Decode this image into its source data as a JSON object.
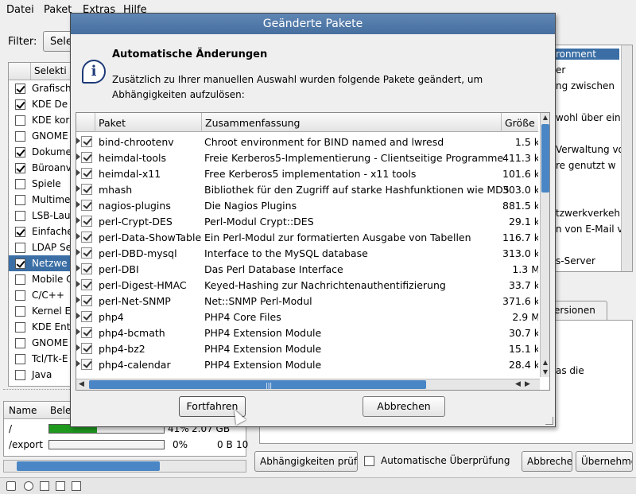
{
  "menubar": {
    "items": [
      "Datei",
      "Paket",
      "Extras",
      "Hilfe"
    ]
  },
  "filter": {
    "label": "Filter:",
    "value": "Sele"
  },
  "selections": {
    "header": "Selekti",
    "items": [
      {
        "label": "Grafisch",
        "checked": true,
        "selected": false
      },
      {
        "label": "KDE De",
        "checked": true,
        "selected": false
      },
      {
        "label": "KDE kor",
        "checked": false,
        "selected": false
      },
      {
        "label": "GNOME",
        "checked": false,
        "selected": false
      },
      {
        "label": "Dokume",
        "checked": true,
        "selected": false
      },
      {
        "label": "Büroanv",
        "checked": true,
        "selected": false
      },
      {
        "label": "Spiele",
        "checked": false,
        "selected": false
      },
      {
        "label": "Multime",
        "checked": false,
        "selected": false
      },
      {
        "label": "LSB-Lau",
        "checked": false,
        "selected": false
      },
      {
        "label": "Einfache",
        "checked": true,
        "selected": false
      },
      {
        "label": "LDAP Se",
        "checked": false,
        "selected": false
      },
      {
        "label": "Netzwe",
        "checked": true,
        "selected": true
      },
      {
        "label": "Mobile C",
        "checked": false,
        "selected": false
      },
      {
        "label": "C/C++",
        "checked": false,
        "selected": false
      },
      {
        "label": "Kernel E",
        "checked": false,
        "selected": false
      },
      {
        "label": "KDE Ent",
        "checked": false,
        "selected": false
      },
      {
        "label": "GNOME",
        "checked": false,
        "selected": false
      },
      {
        "label": "Tcl/Tk-E",
        "checked": false,
        "selected": false
      },
      {
        "label": "Java",
        "checked": false,
        "selected": false
      }
    ]
  },
  "disk_usage": {
    "headers": {
      "name": "Name",
      "used": "Bele"
    },
    "rows": [
      {
        "name": "/",
        "percent_text": "41%",
        "fill": 0.41,
        "used": "2.07 GB"
      },
      {
        "name": "/export",
        "percent_text": "0%",
        "fill": 0.0,
        "used": "0 B",
        "free": "10"
      }
    ]
  },
  "right_panel": {
    "lines": [
      {
        "text": "ronment",
        "selected": true
      },
      {
        "text": "er",
        "selected": false
      },
      {
        "text": "ng zwischen",
        "selected": false
      },
      {
        "text": "wohl über ein",
        "selected": false
      },
      {
        "text": "Verwaltung vo",
        "selected": false
      },
      {
        "text": "re genutzt w",
        "selected": false
      },
      {
        "text": "tzwerkverkehr",
        "selected": false
      },
      {
        "text": "n von E-Mail v",
        "selected": false
      },
      {
        "text": "s-Server",
        "selected": false
      }
    ]
  },
  "tabs": {
    "versions": "ersionen"
  },
  "description": {
    "fragment": "as die"
  },
  "bottom_buttons": {
    "deps": "Abhängigkeiten prüfen",
    "auto_check": "Automatische Überprüfung",
    "cancel": "Abbrechen",
    "accept": "Übernehmen"
  },
  "dialog": {
    "title": "Geänderte Pakete",
    "heading": "Automatische Änderungen",
    "description": "Zusätzlich zu Ihrer manuellen Auswahl wurden folgende Pakete geändert, um Abhängigkeiten aufzulösen:",
    "columns": {
      "package": "Paket",
      "summary": "Zusammenfassung",
      "size": "Größe"
    },
    "packages": [
      {
        "name": "bind-chrootenv",
        "summary": "Chroot environment for BIND named and lwresd",
        "size": "1.5 k"
      },
      {
        "name": "heimdal-tools",
        "summary": "Freie Kerberos5-Implementierung - Clientseitige Programme",
        "size": "411.3 k"
      },
      {
        "name": "heimdal-x11",
        "summary": "Free Kerberos5 implementation - x11 tools",
        "size": "101.6 k"
      },
      {
        "name": "mhash",
        "summary": "Bibliothek für den Zugriff auf starke Hashfunktionen wie MD5",
        "size": "303.0 k"
      },
      {
        "name": "nagios-plugins",
        "summary": "Die Nagios Plugins",
        "size": "881.5 k"
      },
      {
        "name": "perl-Crypt-DES",
        "summary": "Perl-Modul Crypt::DES",
        "size": "29.1 k"
      },
      {
        "name": "perl-Data-ShowTable",
        "summary": "Ein Perl-Modul zur formatierten Ausgabe von Tabellen",
        "size": "116.7 k"
      },
      {
        "name": "perl-DBD-mysql",
        "summary": "Interface to the MySQL database",
        "size": "313.0 k"
      },
      {
        "name": "perl-DBI",
        "summary": "Das Perl Database Interface",
        "size": "1.3 M"
      },
      {
        "name": "perl-Digest-HMAC",
        "summary": "Keyed-Hashing zur Nachrichtenauthentifizierung",
        "size": "33.7 k"
      },
      {
        "name": "perl-Net-SNMP",
        "summary": "Net::SNMP Perl-Modul",
        "size": "371.6 k"
      },
      {
        "name": "php4",
        "summary": "PHP4 Core Files",
        "size": "2.9 M"
      },
      {
        "name": "php4-bcmath",
        "summary": "PHP4 Extension Module",
        "size": "30.7 k"
      },
      {
        "name": "php4-bz2",
        "summary": "PHP4 Extension Module",
        "size": "15.1 k"
      },
      {
        "name": "php4-calendar",
        "summary": "PHP4 Extension Module",
        "size": "28.4 k"
      }
    ],
    "buttons": {
      "continue": "Fortfahren",
      "cancel": "Abbrechen"
    }
  }
}
